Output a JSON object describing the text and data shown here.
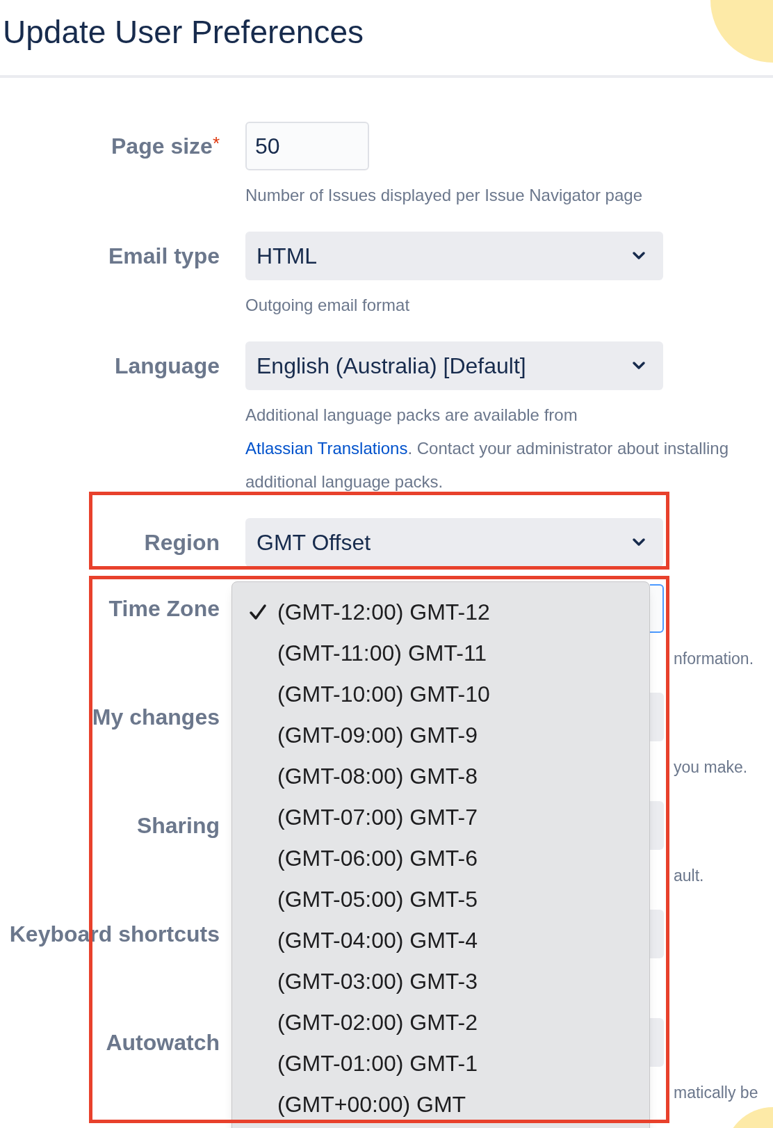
{
  "title": "Update User Preferences",
  "fields": [
    {
      "label": "Page size",
      "required_mark": "*",
      "kind": "input",
      "value": "50",
      "hint": [
        {
          "text": "Number of Issues displayed per Issue Navigator page",
          "kind": "text"
        }
      ]
    },
    {
      "label": "Email type",
      "kind": "select",
      "value": "HTML",
      "hint": [
        {
          "text": "Outgoing email format",
          "kind": "text"
        }
      ]
    },
    {
      "label": "Language",
      "kind": "select",
      "value": "English (Australia) [Default]",
      "hint": [
        {
          "text": "Additional language packs are available from",
          "kind": "text"
        },
        {
          "text": "Atlassian Translations",
          "kind": "link"
        },
        {
          "text": ". Contact your administrator about installing additional language packs.",
          "kind": "text"
        }
      ]
    },
    {
      "label": "Region",
      "kind": "select",
      "value": "GMT Offset"
    }
  ],
  "covered_fields": [
    {
      "label": "Time Zone",
      "focused": true,
      "hint": "nformation."
    },
    {
      "label": "My changes",
      "focused": false,
      "hint": "you make."
    },
    {
      "label": "Sharing",
      "focused": false,
      "hint": "ault."
    },
    {
      "label": "Keyboard shortcuts",
      "focused": false
    },
    {
      "label": "Autowatch",
      "focused": false,
      "hint": "matically be"
    }
  ],
  "dropdown": [
    {
      "label": "(GMT-12:00) GMT-12",
      "selected": true
    },
    {
      "label": "(GMT-11:00) GMT-11",
      "selected": false
    },
    {
      "label": "(GMT-10:00) GMT-10",
      "selected": false
    },
    {
      "label": "(GMT-09:00) GMT-9",
      "selected": false
    },
    {
      "label": "(GMT-08:00) GMT-8",
      "selected": false
    },
    {
      "label": "(GMT-07:00) GMT-7",
      "selected": false
    },
    {
      "label": "(GMT-06:00) GMT-6",
      "selected": false
    },
    {
      "label": "(GMT-05:00) GMT-5",
      "selected": false
    },
    {
      "label": "(GMT-04:00) GMT-4",
      "selected": false
    },
    {
      "label": "(GMT-03:00) GMT-3",
      "selected": false
    },
    {
      "label": "(GMT-02:00) GMT-2",
      "selected": false
    },
    {
      "label": "(GMT-01:00) GMT-1",
      "selected": false
    },
    {
      "label": "(GMT+00:00) GMT",
      "selected": false
    }
  ]
}
